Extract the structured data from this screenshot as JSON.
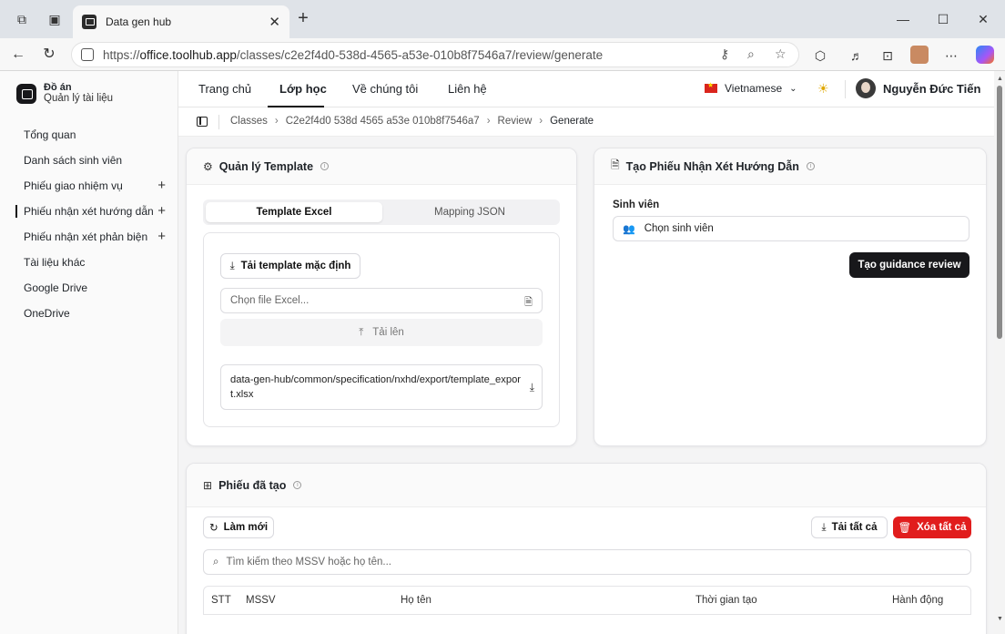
{
  "browser": {
    "tab_title": "Data gen hub",
    "tab_close": "✕",
    "new_tab": "+",
    "url_prefix": "https://",
    "url_host": "office.toolhub.app",
    "url_path": "/classes/c2e2f4d0-538d-4565-a53e-010b8f7546a7/review/generate",
    "window": {
      "minimize": "—",
      "maximize": "☐",
      "close": "✕"
    }
  },
  "sidebar": {
    "brand_title": "Đồ án",
    "brand_subtitle": "Quản lý tài liệu",
    "items": [
      {
        "label": "Tổng quan",
        "plus": ""
      },
      {
        "label": "Danh sách sinh viên",
        "plus": ""
      },
      {
        "label": "Phiếu giao nhiệm vụ",
        "plus": "+"
      },
      {
        "label": "Phiếu nhận xét hướng dẫn",
        "plus": "+"
      },
      {
        "label": "Phiếu nhận xét phản biện",
        "plus": "+"
      },
      {
        "label": "Tài liệu khác",
        "plus": ""
      },
      {
        "label": "Google Drive",
        "plus": ""
      },
      {
        "label": "OneDrive",
        "plus": ""
      }
    ],
    "active_index": 3
  },
  "topnav": {
    "links": [
      "Trang chủ",
      "Lớp học",
      "Về chúng tôi",
      "Liên hệ"
    ],
    "active_index": 1,
    "language": "Vietnamese",
    "user_name": "Nguyễn Đức Tiến"
  },
  "breadcrumb": {
    "items": [
      "Classes",
      "C2e2f4d0 538d 4565 a53e 010b8f7546a7",
      "Review",
      "Generate"
    ],
    "separator": "›"
  },
  "template_card": {
    "title": "Quản lý Template",
    "tabs": [
      "Template Excel",
      "Mapping JSON"
    ],
    "active_tab": 0,
    "download_default_label": "Tải template mặc định",
    "file_placeholder": "Chọn file Excel...",
    "upload_label": "Tải lên",
    "file_path": "data-gen-hub/common/specification/nxhd/export/template_export.xlsx"
  },
  "generate_card": {
    "title": "Tạo Phiếu Nhận Xét Hướng Dẫn",
    "student_label": "Sinh viên",
    "student_placeholder": "Chọn sinh viên",
    "submit_label": "Tạo guidance review"
  },
  "created_card": {
    "title": "Phiếu đã tạo",
    "refresh_label": "Làm mới",
    "download_all_label": "Tải tất cả",
    "delete_all_label": "Xóa tất cả",
    "search_placeholder": "Tìm kiếm theo MSSV hoặc họ tên...",
    "columns": [
      "STT",
      "MSSV",
      "Họ tên",
      "Thời gian tạo",
      "Hành động"
    ]
  },
  "colors": {
    "primary_dark": "#18181b",
    "danger": "#e11d1d",
    "sidebar_bg": "#fafafa"
  }
}
